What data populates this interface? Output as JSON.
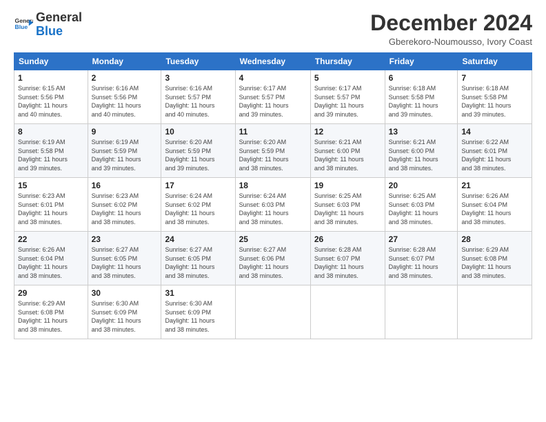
{
  "logo": {
    "line1": "General",
    "line2": "Blue"
  },
  "header": {
    "month": "December 2024",
    "location": "Gberekoro-Noumousso, Ivory Coast"
  },
  "weekdays": [
    "Sunday",
    "Monday",
    "Tuesday",
    "Wednesday",
    "Thursday",
    "Friday",
    "Saturday"
  ],
  "weeks": [
    [
      {
        "day": "1",
        "info": "Sunrise: 6:15 AM\nSunset: 5:56 PM\nDaylight: 11 hours\nand 40 minutes."
      },
      {
        "day": "2",
        "info": "Sunrise: 6:16 AM\nSunset: 5:56 PM\nDaylight: 11 hours\nand 40 minutes."
      },
      {
        "day": "3",
        "info": "Sunrise: 6:16 AM\nSunset: 5:57 PM\nDaylight: 11 hours\nand 40 minutes."
      },
      {
        "day": "4",
        "info": "Sunrise: 6:17 AM\nSunset: 5:57 PM\nDaylight: 11 hours\nand 39 minutes."
      },
      {
        "day": "5",
        "info": "Sunrise: 6:17 AM\nSunset: 5:57 PM\nDaylight: 11 hours\nand 39 minutes."
      },
      {
        "day": "6",
        "info": "Sunrise: 6:18 AM\nSunset: 5:58 PM\nDaylight: 11 hours\nand 39 minutes."
      },
      {
        "day": "7",
        "info": "Sunrise: 6:18 AM\nSunset: 5:58 PM\nDaylight: 11 hours\nand 39 minutes."
      }
    ],
    [
      {
        "day": "8",
        "info": "Sunrise: 6:19 AM\nSunset: 5:58 PM\nDaylight: 11 hours\nand 39 minutes."
      },
      {
        "day": "9",
        "info": "Sunrise: 6:19 AM\nSunset: 5:59 PM\nDaylight: 11 hours\nand 39 minutes."
      },
      {
        "day": "10",
        "info": "Sunrise: 6:20 AM\nSunset: 5:59 PM\nDaylight: 11 hours\nand 39 minutes."
      },
      {
        "day": "11",
        "info": "Sunrise: 6:20 AM\nSunset: 5:59 PM\nDaylight: 11 hours\nand 38 minutes."
      },
      {
        "day": "12",
        "info": "Sunrise: 6:21 AM\nSunset: 6:00 PM\nDaylight: 11 hours\nand 38 minutes."
      },
      {
        "day": "13",
        "info": "Sunrise: 6:21 AM\nSunset: 6:00 PM\nDaylight: 11 hours\nand 38 minutes."
      },
      {
        "day": "14",
        "info": "Sunrise: 6:22 AM\nSunset: 6:01 PM\nDaylight: 11 hours\nand 38 minutes."
      }
    ],
    [
      {
        "day": "15",
        "info": "Sunrise: 6:23 AM\nSunset: 6:01 PM\nDaylight: 11 hours\nand 38 minutes."
      },
      {
        "day": "16",
        "info": "Sunrise: 6:23 AM\nSunset: 6:02 PM\nDaylight: 11 hours\nand 38 minutes."
      },
      {
        "day": "17",
        "info": "Sunrise: 6:24 AM\nSunset: 6:02 PM\nDaylight: 11 hours\nand 38 minutes."
      },
      {
        "day": "18",
        "info": "Sunrise: 6:24 AM\nSunset: 6:03 PM\nDaylight: 11 hours\nand 38 minutes."
      },
      {
        "day": "19",
        "info": "Sunrise: 6:25 AM\nSunset: 6:03 PM\nDaylight: 11 hours\nand 38 minutes."
      },
      {
        "day": "20",
        "info": "Sunrise: 6:25 AM\nSunset: 6:03 PM\nDaylight: 11 hours\nand 38 minutes."
      },
      {
        "day": "21",
        "info": "Sunrise: 6:26 AM\nSunset: 6:04 PM\nDaylight: 11 hours\nand 38 minutes."
      }
    ],
    [
      {
        "day": "22",
        "info": "Sunrise: 6:26 AM\nSunset: 6:04 PM\nDaylight: 11 hours\nand 38 minutes."
      },
      {
        "day": "23",
        "info": "Sunrise: 6:27 AM\nSunset: 6:05 PM\nDaylight: 11 hours\nand 38 minutes."
      },
      {
        "day": "24",
        "info": "Sunrise: 6:27 AM\nSunset: 6:05 PM\nDaylight: 11 hours\nand 38 minutes."
      },
      {
        "day": "25",
        "info": "Sunrise: 6:27 AM\nSunset: 6:06 PM\nDaylight: 11 hours\nand 38 minutes."
      },
      {
        "day": "26",
        "info": "Sunrise: 6:28 AM\nSunset: 6:07 PM\nDaylight: 11 hours\nand 38 minutes."
      },
      {
        "day": "27",
        "info": "Sunrise: 6:28 AM\nSunset: 6:07 PM\nDaylight: 11 hours\nand 38 minutes."
      },
      {
        "day": "28",
        "info": "Sunrise: 6:29 AM\nSunset: 6:08 PM\nDaylight: 11 hours\nand 38 minutes."
      }
    ],
    [
      {
        "day": "29",
        "info": "Sunrise: 6:29 AM\nSunset: 6:08 PM\nDaylight: 11 hours\nand 38 minutes."
      },
      {
        "day": "30",
        "info": "Sunrise: 6:30 AM\nSunset: 6:09 PM\nDaylight: 11 hours\nand 38 minutes."
      },
      {
        "day": "31",
        "info": "Sunrise: 6:30 AM\nSunset: 6:09 PM\nDaylight: 11 hours\nand 38 minutes."
      },
      {
        "day": "",
        "info": ""
      },
      {
        "day": "",
        "info": ""
      },
      {
        "day": "",
        "info": ""
      },
      {
        "day": "",
        "info": ""
      }
    ]
  ]
}
